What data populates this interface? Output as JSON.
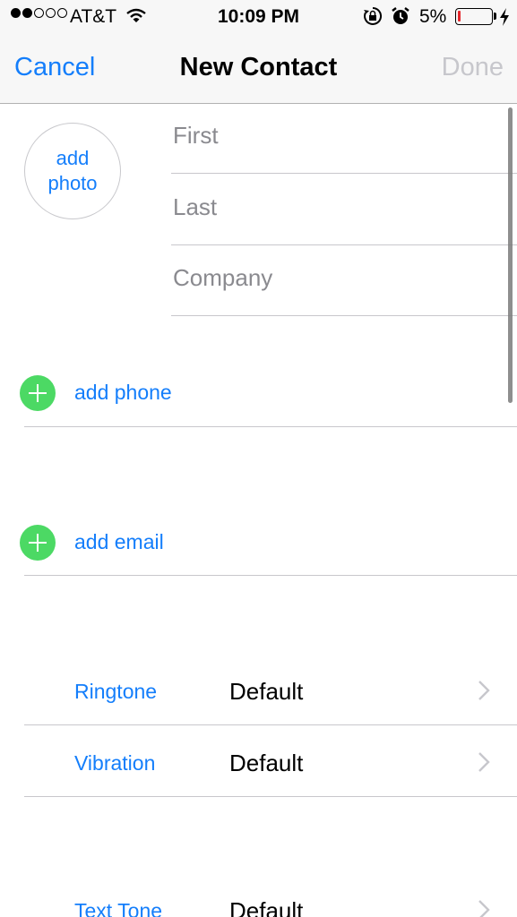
{
  "status_bar": {
    "carrier": "AT&T",
    "time": "10:09 PM",
    "battery_percent": "5%",
    "signal_bars_filled": 2,
    "signal_bars_total": 5,
    "icons": [
      "wifi-icon",
      "rotation-lock-icon",
      "alarm-icon",
      "battery-icon",
      "charging-bolt-icon"
    ]
  },
  "nav": {
    "cancel_label": "Cancel",
    "title": "New Contact",
    "done_label": "Done"
  },
  "photo": {
    "line1": "add",
    "line2": "photo"
  },
  "name_fields": {
    "first_placeholder": "First",
    "last_placeholder": "Last",
    "company_placeholder": "Company",
    "first_value": "",
    "last_value": "",
    "company_value": ""
  },
  "add_phone_label": "add phone",
  "add_email_label": "add email",
  "settings": [
    {
      "label": "Ringtone",
      "value": "Default"
    },
    {
      "label": "Vibration",
      "value": "Default"
    },
    {
      "label": "Text Tone",
      "value": "Default"
    }
  ],
  "colors": {
    "accent": "#147efb",
    "add_green": "#4cd964",
    "done_disabled": "#c7c7cc",
    "battery_low": "#e4262b"
  }
}
